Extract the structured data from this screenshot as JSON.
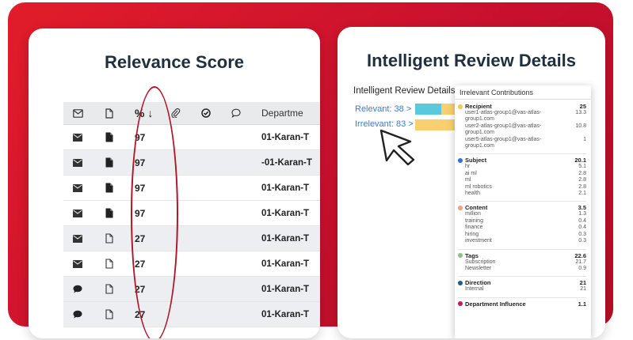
{
  "left": {
    "title": "Relevance Score",
    "header": {
      "score_col": "% ↓",
      "department_col": "Departme"
    },
    "rows": [
      {
        "type": "email",
        "doc": "filled",
        "score": "97",
        "dept": "01-Karan-T",
        "shade": false
      },
      {
        "type": "email",
        "doc": "filled",
        "score": "97",
        "dept": "-01-Karan-T",
        "shade": true
      },
      {
        "type": "email",
        "doc": "filled",
        "score": "97",
        "dept": "01-Karan-T",
        "shade": false
      },
      {
        "type": "email",
        "doc": "filled",
        "score": "97",
        "dept": "01-Karan-T",
        "shade": false
      },
      {
        "type": "email",
        "doc": "outline",
        "score": "27",
        "dept": "01-Karan-T",
        "shade": true
      },
      {
        "type": "email",
        "doc": "outline",
        "score": "27",
        "dept": "01-Karan-T",
        "shade": false
      },
      {
        "type": "chat",
        "doc": "outline",
        "score": "27",
        "dept": "01-Karan-T",
        "shade": true
      },
      {
        "type": "chat",
        "doc": "outline",
        "score": "27",
        "dept": "01-Karan-T",
        "shade": true
      }
    ]
  },
  "right": {
    "title": "Intelligent Review Details",
    "label": "Intelligent Review Details",
    "relevant": {
      "label": "Relevant: 38 >",
      "value": 38
    },
    "irrelevant": {
      "label": "Irrelevant: 83 >",
      "value": 83
    },
    "colors": {
      "teal": "#5bc8dc",
      "yellow": "#f7d170"
    },
    "popup": {
      "title": "Irrelevant Contributions",
      "groups": [
        {
          "name": "Recipient",
          "total": "25",
          "color": "#f2c94c",
          "items": [
            {
              "label": "user1-atlas-group1@vas-atlas-group1.com",
              "value": "13.3"
            },
            {
              "label": "user2-atlas-group1@vas-atlas-group1.com",
              "value": "10.8"
            },
            {
              "label": "user5-atlas-group1@vas-atlas-group1.com",
              "value": "1"
            }
          ]
        },
        {
          "name": "Subject",
          "total": "20.1",
          "color": "#2f6fd6",
          "items": [
            {
              "label": "hr",
              "value": "5.1"
            },
            {
              "label": "ai ml",
              "value": "2.8"
            },
            {
              "label": "ml",
              "value": "2.8"
            },
            {
              "label": "ml robotics",
              "value": "2.8"
            },
            {
              "label": "health",
              "value": "2.1"
            }
          ]
        },
        {
          "name": "Content",
          "total": "3.5",
          "color": "#f0a07a",
          "items": [
            {
              "label": "million",
              "value": "1.3"
            },
            {
              "label": "training",
              "value": "0.4"
            },
            {
              "label": "finance",
              "value": "0.4"
            },
            {
              "label": "hiring",
              "value": "0.3"
            },
            {
              "label": "investment",
              "value": "0.3"
            }
          ]
        },
        {
          "name": "Tags",
          "total": "22.6",
          "color": "#8bc08a",
          "items": [
            {
              "label": "Subscription",
              "value": "21.7"
            },
            {
              "label": "Newsletter",
              "value": "0.9"
            }
          ]
        },
        {
          "name": "Direction",
          "total": "21",
          "color": "#1f5a8a",
          "items": [
            {
              "label": "Internal",
              "value": "21"
            }
          ]
        },
        {
          "name": "Department Influence",
          "total": "1.1",
          "color": "#c2185b",
          "items": []
        }
      ]
    }
  }
}
